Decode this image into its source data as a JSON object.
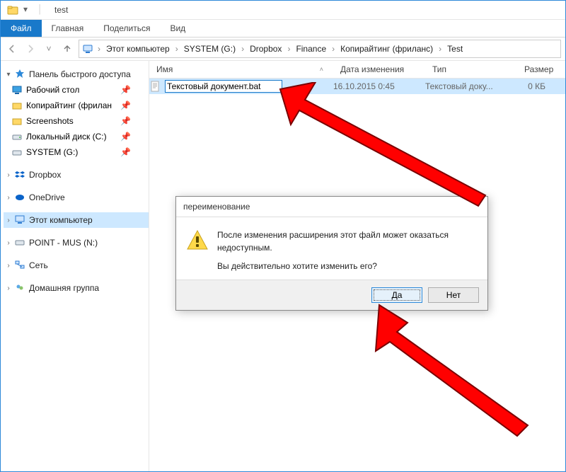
{
  "window": {
    "title": "test"
  },
  "ribbon": {
    "file": "Файл",
    "home": "Главная",
    "share": "Поделиться",
    "view": "Вид"
  },
  "breadcrumbs": {
    "items": [
      "Этот компьютер",
      "SYSTEM (G:)",
      "Dropbox",
      "Finance",
      "Копирайтинг (фриланс)",
      "Test"
    ]
  },
  "nav": {
    "quick_access": "Панель быстрого доступа",
    "desktop": "Рабочий стол",
    "copywriting": "Копирайтинг (фрилан",
    "screenshots": "Screenshots",
    "local_c": "Локальный диск (C:)",
    "system_g": "SYSTEM (G:)",
    "dropbox": "Dropbox",
    "onedrive": "OneDrive",
    "this_pc": "Этот компьютер",
    "point_mus": "POINT - MUS (N:)",
    "network": "Сеть",
    "homegroup": "Домашняя группа"
  },
  "columns": {
    "name": "Имя",
    "date": "Дата изменения",
    "type": "Тип",
    "size": "Размер"
  },
  "file": {
    "rename_value": "Текстовый документ.bat",
    "date": "16.10.2015 0:45",
    "type": "Текстовый доку...",
    "size": "0 КБ"
  },
  "dialog": {
    "title": "переименование",
    "line1": "После изменения расширения этот файл может оказаться недоступным.",
    "line2": "Вы действительно хотите изменить его?",
    "yes": "Да",
    "no": "Нет"
  }
}
